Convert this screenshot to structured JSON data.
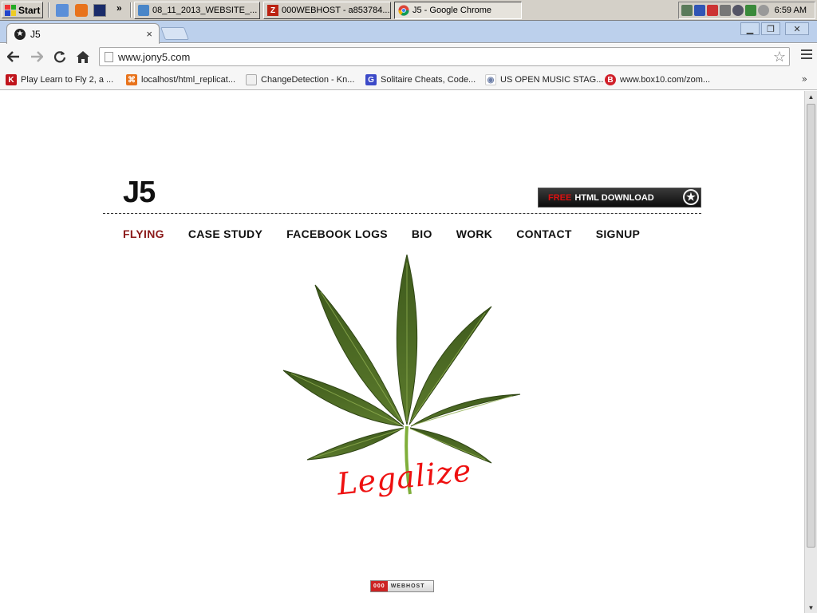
{
  "taskbar": {
    "start_label": "Start",
    "more_label": "»",
    "tasks": [
      {
        "label": "08_11_2013_WEBSITE_...",
        "icon": "document-icon",
        "active": false
      },
      {
        "label": "000WEBHOST - a853784...",
        "icon": "filezilla-icon",
        "active": false
      },
      {
        "label": "J5 - Google Chrome",
        "icon": "chrome-icon",
        "active": true
      }
    ],
    "clock": "6:59 AM"
  },
  "browser": {
    "tab_title": "J5",
    "tab_close": "×",
    "url": "www.jony5.com",
    "bookmarks": [
      {
        "label": "Play Learn to Fly 2, a ...",
        "icon": "K",
        "color": "#c0141c"
      },
      {
        "label": "localhost/html_replicat...",
        "icon": "⌘",
        "color": "#e8731c"
      },
      {
        "label": "ChangeDetection - Kn...",
        "icon": "",
        "color": "#d8d8d8"
      },
      {
        "label": "Solitaire Cheats, Code...",
        "icon": "G",
        "color": "#3c4ac8"
      },
      {
        "label": "US OPEN MUSIC STAG...",
        "icon": "◉",
        "color": "#6d7fa8"
      },
      {
        "label": "www.box10.com/zom...",
        "icon": "B",
        "color": "#d0202a"
      }
    ],
    "bookmarks_more": "»"
  },
  "page": {
    "logo": "J5",
    "download_button": {
      "free": "FREE",
      "label": "HTML DOWNLOAD"
    },
    "nav": [
      "FLYING",
      "CASE STUDY",
      "FACEBOOK LOGS",
      "BIO",
      "WORK",
      "CONTACT",
      "SIGNUP"
    ],
    "current_nav": "FLYING",
    "hero_caption": "Legalize",
    "footer_badge": {
      "red": "000",
      "text": "WEBHOST"
    }
  },
  "colors": {
    "nav_current": "#8b1a1a",
    "caption": "#e11111",
    "leaf": "#4f6a26"
  }
}
